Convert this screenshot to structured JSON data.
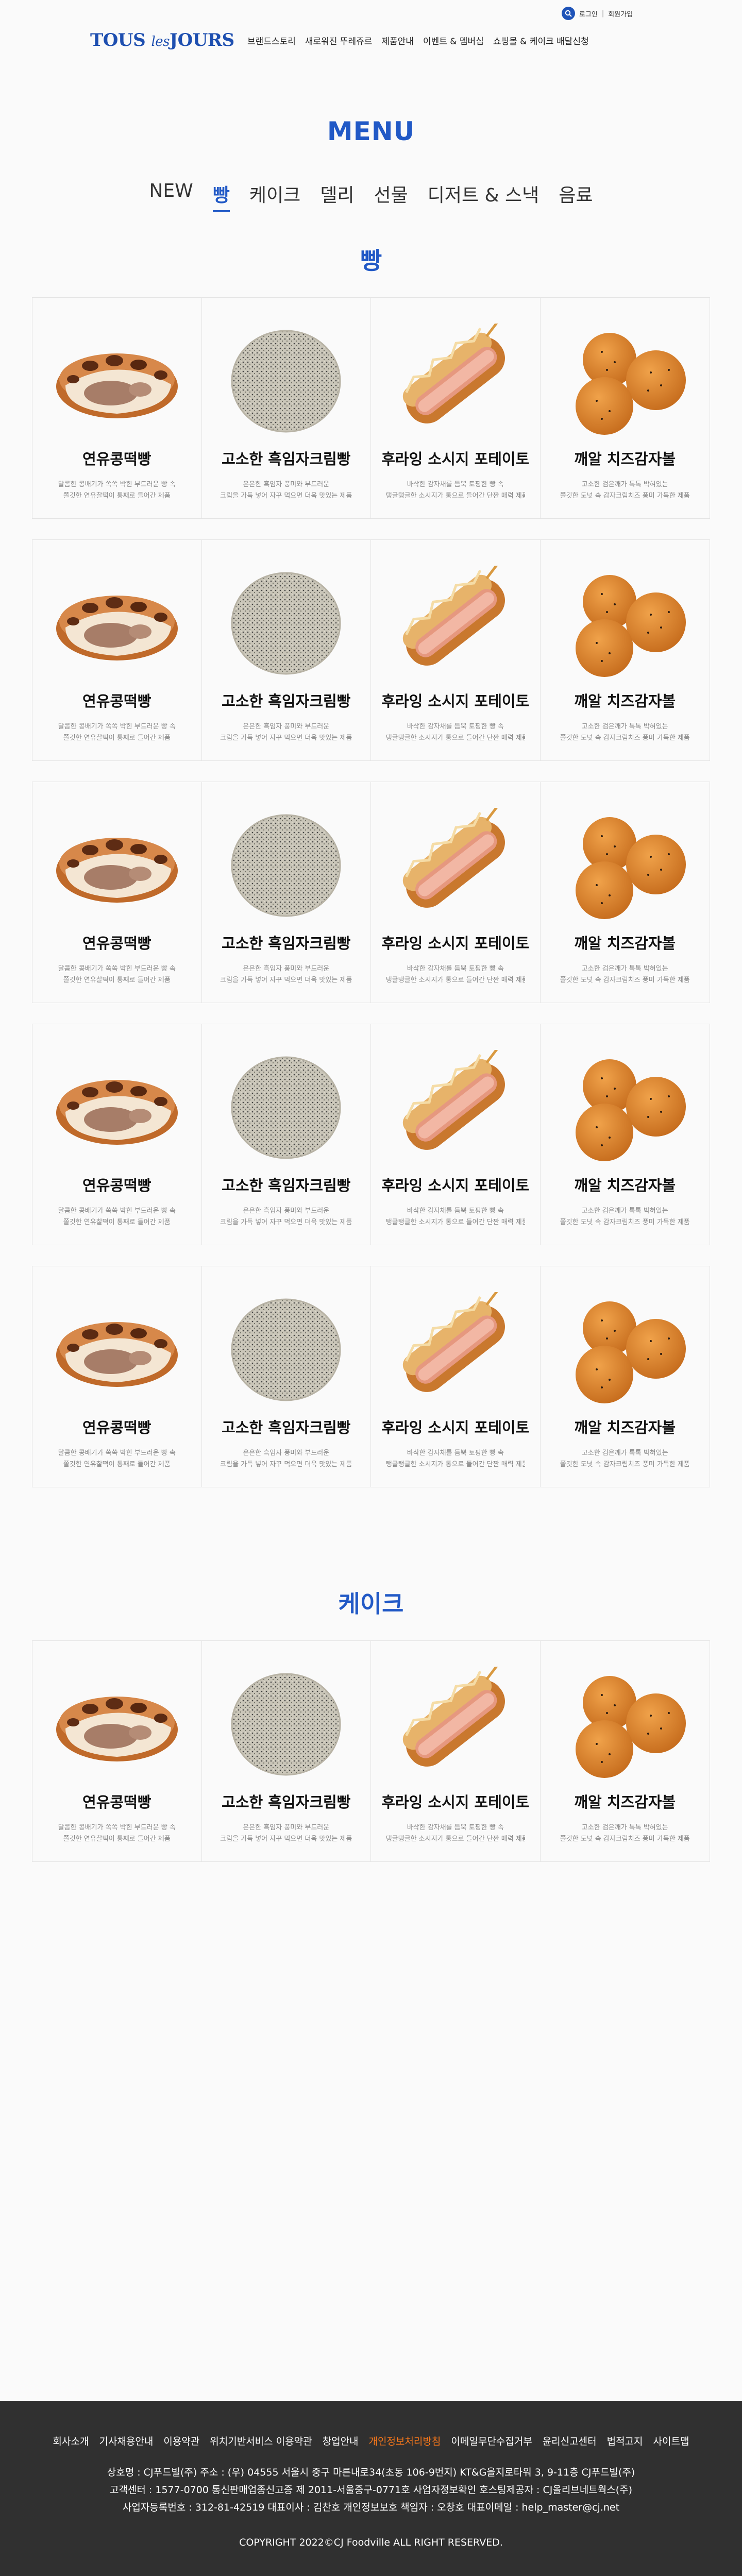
{
  "topbar": {
    "login": "로그인",
    "separator": "|",
    "signup": "회원가입"
  },
  "brand": {
    "logo_main": "TOUS",
    "logo_les": "les",
    "logo_end": "JOURS",
    "color": "#1e4fb0"
  },
  "gnb": [
    {
      "label": "브랜드스토리",
      "name": "gnb-brand-story"
    },
    {
      "label": "새로워진 뚜레쥬르",
      "name": "gnb-new-tous-les-jours"
    },
    {
      "label": "제품안내",
      "name": "gnb-products"
    },
    {
      "label": "이벤트 & 멤버십",
      "name": "gnb-event-membership"
    },
    {
      "label": "쇼핑몰 & 케이크 배달신청",
      "name": "gnb-shop-delivery"
    }
  ],
  "page": {
    "title": "MENU",
    "accent": "#2159c6"
  },
  "tabs": [
    {
      "label": "NEW",
      "active": false
    },
    {
      "label": "빵",
      "active": true
    },
    {
      "label": "케이크",
      "active": false
    },
    {
      "label": "델리",
      "active": false
    },
    {
      "label": "선물",
      "active": false
    },
    {
      "label": "디저트 & 스낵",
      "active": false
    },
    {
      "label": "음료",
      "active": false
    }
  ],
  "sections": [
    {
      "title": "빵",
      "rows": 5
    },
    {
      "title": "케이크",
      "rows": 1
    }
  ],
  "products": [
    {
      "name": "연유콩떡빵",
      "icon": "condensed-milk-bean-bread-image",
      "desc1": "달콤한 콩배기가 쏙쏙 박힌 부드러운 빵 속",
      "desc2": "쫄깃한 연유찰떡이 통째로 들어간 제품"
    },
    {
      "name": "고소한 흑임자크림빵",
      "icon": "black-sesame-cream-bread-image",
      "desc1": "은은한 흑임자 풍미와 부드러운",
      "desc2": "크림을 가득 넣어 자꾸 먹으면 더욱 맛있는 제품"
    },
    {
      "name": "후라잉 소시지 포테이토",
      "icon": "frying-sausage-potato-image",
      "desc1": "바삭한 감자채를 듬뿍 토핑한 빵 속",
      "desc2": "탱글탱글한 소시지가 통으로 들어간 단짠 매력 제품"
    },
    {
      "name": "깨알 치즈감자볼",
      "icon": "sesame-cheese-potato-ball-image",
      "desc1": "고소한 검은깨가 톡톡 박혀있는",
      "desc2": "쫄깃한 도넛 속 감자크림치즈 풍미 가득한 제품"
    }
  ],
  "footer": {
    "links": [
      {
        "label": "회사소개",
        "highlight": false
      },
      {
        "label": "기사채용안내",
        "highlight": false
      },
      {
        "label": "이용약관",
        "highlight": false
      },
      {
        "label": "위치기반서비스 이용약관",
        "highlight": false
      },
      {
        "label": "창업안내",
        "highlight": false
      },
      {
        "label": "개인정보처리방침",
        "highlight": true
      },
      {
        "label": "이메일무단수집거부",
        "highlight": false
      },
      {
        "label": "윤리신고센터",
        "highlight": false
      },
      {
        "label": "법적고지",
        "highlight": false
      },
      {
        "label": "사이트맵",
        "highlight": false
      }
    ],
    "info_line1": "상호명 : CJ푸드빌(주) 주소 : (우) 04555 서울시 중구 마른내로34(초동 106-9번지) KT&G을지로타워 3, 9-11층 CJ푸드빌(주)",
    "info_line2": "고객센터 : 1577-0700   통신판매업종신고증 제 2011-서울중구-0771호   사업자정보확인   호스팅제공자 : CJ올리브네트웍스(주)",
    "info_line3": "사업자등록번호 : 312-81-42519 대표이사 : 김찬호   개인정보보호 책임자 : 오창호   대표이메일 : help_master@cj.net",
    "copyright": "COPYRIGHT 2022©CJ Foodville ALL RIGHT RESERVED.",
    "highlight_color": "#ff7a1a"
  }
}
